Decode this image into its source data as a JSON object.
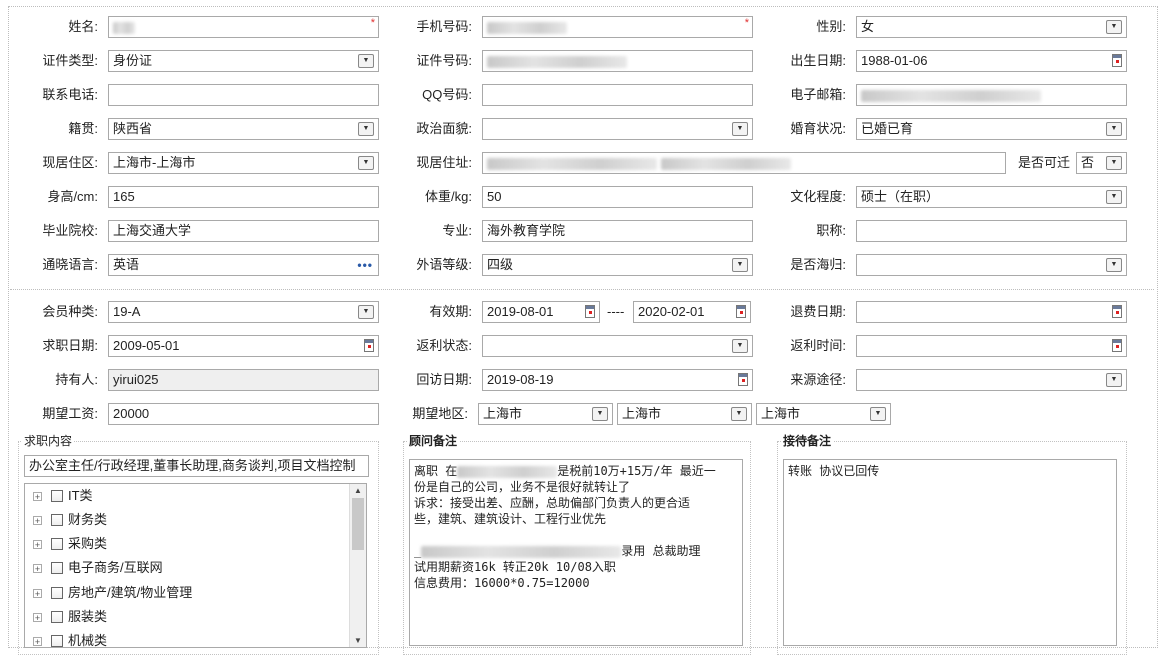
{
  "person": {
    "name_label": "姓名:",
    "phone_label": "手机号码:",
    "gender_label": "性别:",
    "gender_value": "女",
    "idtype_label": "证件类型:",
    "idtype_value": "身份证",
    "idno_label": "证件号码:",
    "birth_label": "出生日期:",
    "birth_value": "1988-01-06",
    "tel_label": "联系电话:",
    "qq_label": "QQ号码:",
    "email_label": "电子邮箱:",
    "native_label": "籍贯:",
    "native_value": "陕西省",
    "politics_label": "政治面貌:",
    "marital_label": "婚育状况:",
    "marital_value": "已婚已育",
    "region_label": "现居住区:",
    "region_value": "上海市-上海市",
    "address_label": "现居住址:",
    "relocate_label": "是否可迁",
    "relocate_value": "否",
    "height_label": "身高/cm:",
    "height_value": "165",
    "weight_label": "体重/kg:",
    "weight_value": "50",
    "edu_label": "文化程度:",
    "edu_value": "硕士（在职）",
    "school_label": "毕业院校:",
    "school_value": "上海交通大学",
    "major_label": "专业:",
    "major_value": "海外教育学院",
    "title_label": "职称:",
    "lang_label": "通晓语言:",
    "lang_value": "英语",
    "lang_more": "•••",
    "langlevel_label": "外语等级:",
    "langlevel_value": "四级",
    "overseas_label": "是否海归:"
  },
  "member": {
    "type_label": "会员种类:",
    "type_value": "19-A",
    "valid_label": "有效期:",
    "valid_from": "2019-08-01",
    "valid_sep": "----",
    "valid_to": "2020-02-01",
    "refund_label": "退费日期:",
    "jobdate_label": "求职日期:",
    "jobdate_value": "2009-05-01",
    "rebate_status_label": "返利状态:",
    "rebate_time_label": "返利时间:",
    "holder_label": "持有人:",
    "holder_value": "yirui025",
    "visit_label": "回访日期:",
    "visit_value": "2019-08-19",
    "source_label": "来源途径:",
    "salary_label": "期望工资:",
    "salary_value": "20000",
    "area_label": "期望地区:",
    "area1": "上海市",
    "area2": "上海市",
    "area3": "上海市"
  },
  "job": {
    "group_title": "求职内容",
    "summary": "办公室主任/行政经理,董事长助理,商务谈判,项目文档控制",
    "tree": [
      "IT类",
      "财务类",
      "采购类",
      "电子商务/互联网",
      "房地产/建筑/物业管理",
      "服装类",
      "机械类"
    ]
  },
  "consultant": {
    "group_title": "顾问备注",
    "line1_pre": "离职 在",
    "line1_post": "是税前10万+15万/年 最近一",
    "line2": "份是自己的公司，业务不是很好就转让了",
    "line3": "诉求：接受出差、应酬，总助偏部门负责人的更合适",
    "line4": "些，建筑、建筑设计、工程行业优先",
    "line5_pre": "_",
    "line5_post": "录用 总裁助理",
    "line6": "试用期薪资16k 转正20k 10/08入职",
    "line7": "信息费用：16000*0.75=12000"
  },
  "reception": {
    "group_title": "接待备注",
    "text": "转账 协议已回传"
  }
}
